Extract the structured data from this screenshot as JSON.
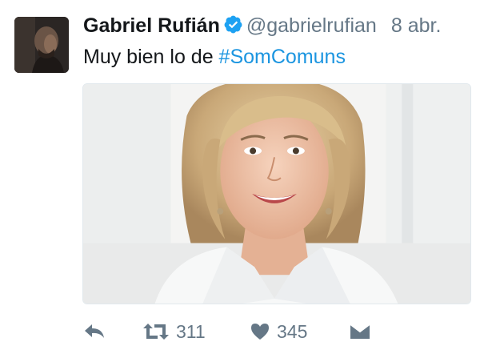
{
  "tweet": {
    "author_name": "Gabriel Rufián",
    "handle": "@gabrielrufian",
    "date": "8 abr.",
    "text_prefix": "Muy bien lo de ",
    "hashtag": "#SomComuns",
    "verified": true
  },
  "actions": {
    "reply": {
      "icon": "reply-icon"
    },
    "retweet": {
      "icon": "retweet-icon",
      "count": "311"
    },
    "like": {
      "icon": "heart-icon",
      "count": "345"
    },
    "message": {
      "icon": "envelope-icon"
    }
  },
  "colors": {
    "text": "#14171a",
    "secondary": "#657786",
    "link": "#1b95e0",
    "verified_badge": "#1da1f2",
    "icon": "#657786"
  }
}
